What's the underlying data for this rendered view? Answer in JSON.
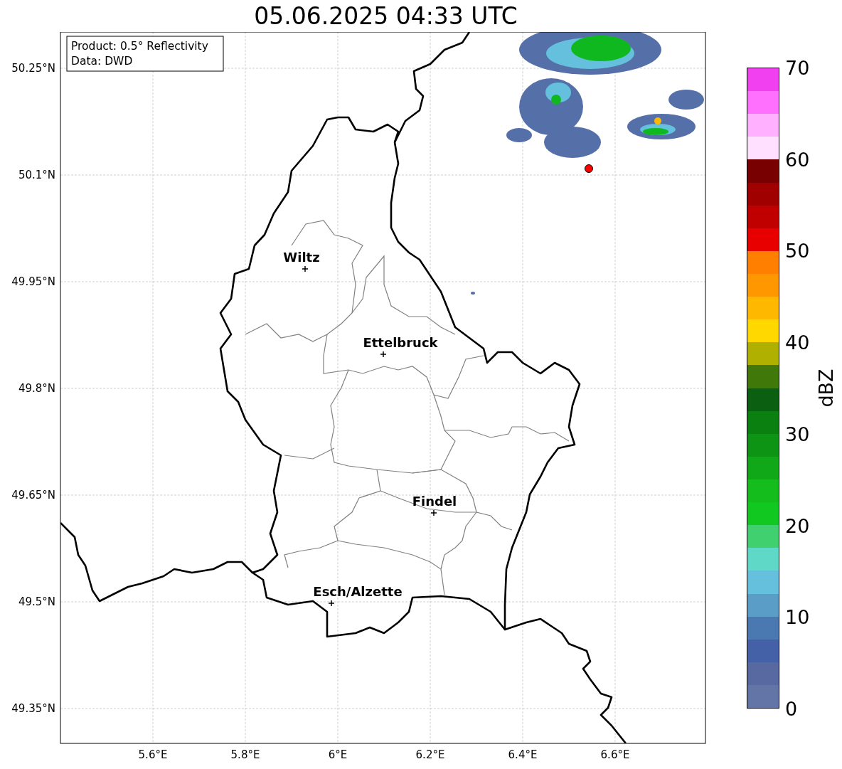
{
  "title": "05.06.2025 04:33 UTC",
  "legend": [
    "Product: 0.5° Reflectivity",
    "Data: DWD"
  ],
  "x_ticks": [
    "5.6°E",
    "5.8°E",
    "6°E",
    "6.2°E",
    "6.4°E",
    "6.6°E"
  ],
  "y_ticks": [
    "50.25°N",
    "50.1°N",
    "49.95°N",
    "49.8°N",
    "49.65°N",
    "49.5°N",
    "49.35°N"
  ],
  "cities": [
    {
      "name": "Wiltz"
    },
    {
      "name": "Ettelbruck"
    },
    {
      "name": "Findel"
    },
    {
      "name": "Esch/Alzette"
    }
  ],
  "colorbar": {
    "label": "dBZ",
    "ticks": [
      "70",
      "60",
      "50",
      "40",
      "30",
      "20",
      "10",
      "0"
    ],
    "bins": [
      {
        "color": "#f040f0"
      },
      {
        "color": "#ff70ff"
      },
      {
        "color": "#ffb0ff"
      },
      {
        "color": "#ffe0ff"
      },
      {
        "color": "#780000"
      },
      {
        "color": "#a00000"
      },
      {
        "color": "#c00000"
      },
      {
        "color": "#e80000"
      },
      {
        "color": "#ff8000"
      },
      {
        "color": "#ff9800"
      },
      {
        "color": "#ffb800"
      },
      {
        "color": "#ffd800"
      },
      {
        "color": "#b0b000"
      },
      {
        "color": "#40780a"
      },
      {
        "color": "#0a6010"
      },
      {
        "color": "#0a8010"
      },
      {
        "color": "#0e9414"
      },
      {
        "color": "#10a818"
      },
      {
        "color": "#14bc1c"
      },
      {
        "color": "#10c820"
      },
      {
        "color": "#40d070"
      },
      {
        "color": "#60d8c8"
      },
      {
        "color": "#64c0dc"
      },
      {
        "color": "#5a9ec8"
      },
      {
        "color": "#4a78b0"
      },
      {
        "color": "#4460a6"
      },
      {
        "color": "#5868a0"
      },
      {
        "color": "#6374a6"
      }
    ]
  }
}
